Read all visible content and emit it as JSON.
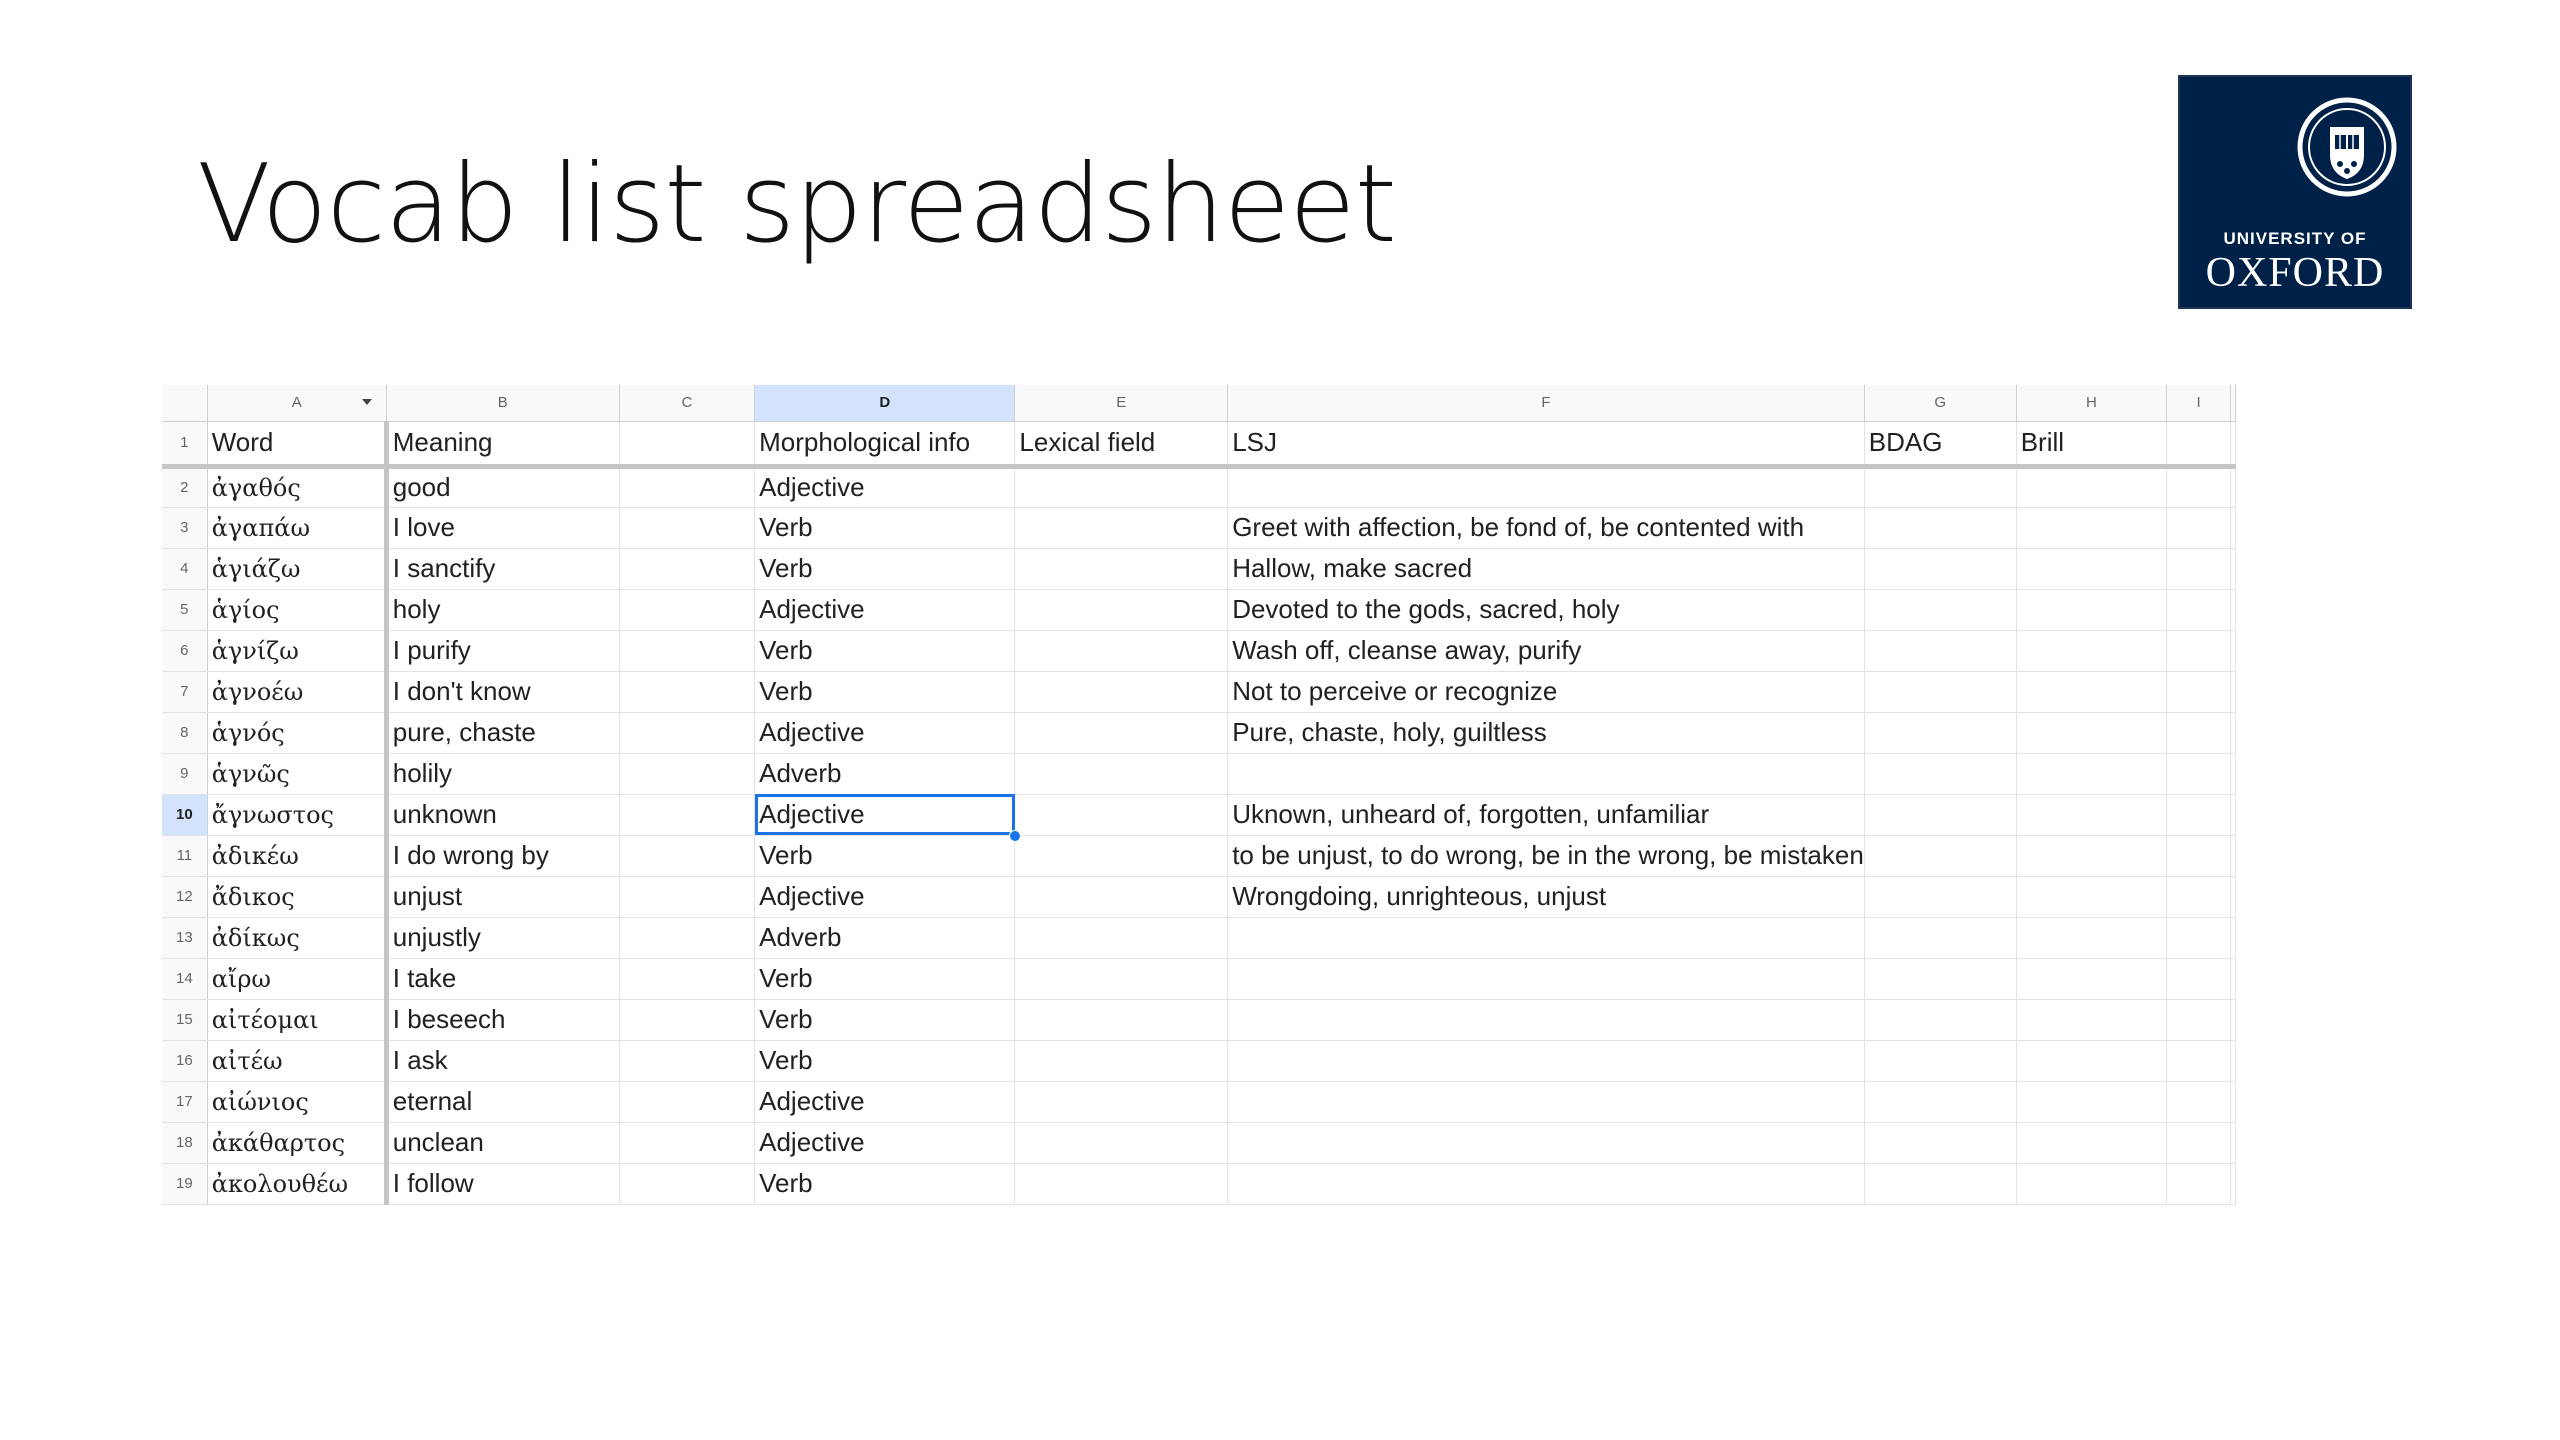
{
  "slide": {
    "title": "Vocab list spreadsheet"
  },
  "logo": {
    "line1": "UNIVERSITY OF",
    "line2": "OXFORD",
    "icon": "oxford-crest-icon",
    "background": "#002147"
  },
  "sheet": {
    "column_letters": [
      "A",
      "B",
      "C",
      "D",
      "E",
      "F",
      "G",
      "H",
      "I"
    ],
    "active_column": "D",
    "active_row": 10,
    "header_row": {
      "row_number": "1",
      "cells": [
        "Word",
        "Meaning",
        "",
        "Morphological info",
        "Lexical field",
        "LSJ",
        "BDAG",
        "Brill",
        ""
      ]
    },
    "rows": [
      {
        "n": "2",
        "word": "ἀγαθός",
        "meaning": "good",
        "c": "",
        "morph": "Adjective",
        "lex": "",
        "lsj": "",
        "bdag": "",
        "brill": ""
      },
      {
        "n": "3",
        "word": "ἀγαπάω",
        "meaning": "I love",
        "c": "",
        "morph": "Verb",
        "lex": "",
        "lsj": "Greet with affection, be fond of, be contented with",
        "bdag": "",
        "brill": ""
      },
      {
        "n": "4",
        "word": "ἁγιάζω",
        "meaning": "I sanctify",
        "c": "",
        "morph": "Verb",
        "lex": "",
        "lsj": "Hallow, make sacred",
        "bdag": "",
        "brill": ""
      },
      {
        "n": "5",
        "word": "ἁγίος",
        "meaning": "holy",
        "c": "",
        "morph": "Adjective",
        "lex": "",
        "lsj": "Devoted to the gods, sacred, holy",
        "bdag": "",
        "brill": ""
      },
      {
        "n": "6",
        "word": "ἁγνίζω",
        "meaning": "I purify",
        "c": "",
        "morph": "Verb",
        "lex": "",
        "lsj": "Wash off, cleanse away, purify",
        "bdag": "",
        "brill": ""
      },
      {
        "n": "7",
        "word": "ἀγνοέω",
        "meaning": "I don't know",
        "c": "",
        "morph": "Verb",
        "lex": "",
        "lsj": "Not to perceive or recognize",
        "bdag": "",
        "brill": ""
      },
      {
        "n": "8",
        "word": "ἁγνός",
        "meaning": "pure, chaste",
        "c": "",
        "morph": "Adjective",
        "lex": "",
        "lsj": "Pure, chaste, holy, guiltless",
        "bdag": "",
        "brill": ""
      },
      {
        "n": "9",
        "word": "ἁγνῶς",
        "meaning": "holily",
        "c": "",
        "morph": "Adverb",
        "lex": "",
        "lsj": "",
        "bdag": "",
        "brill": ""
      },
      {
        "n": "10",
        "word": "ἄγνωστος",
        "meaning": "unknown",
        "c": "",
        "morph": "Adjective",
        "lex": "",
        "lsj": "Uknown, unheard of, forgotten, unfamiliar",
        "bdag": "",
        "brill": ""
      },
      {
        "n": "11",
        "word": "ἀδικέω",
        "meaning": "I do wrong by",
        "c": "",
        "morph": "Verb",
        "lex": "",
        "lsj": "to be unjust, to do wrong, be in the wrong, be mistaken",
        "bdag": "",
        "brill": ""
      },
      {
        "n": "12",
        "word": "ἄδικος",
        "meaning": "unjust",
        "c": "",
        "morph": "Adjective",
        "lex": "",
        "lsj": "Wrongdoing, unrighteous, unjust",
        "bdag": "",
        "brill": ""
      },
      {
        "n": "13",
        "word": "ἀδίκως",
        "meaning": "unjustly",
        "c": "",
        "morph": "Adverb",
        "lex": "",
        "lsj": "",
        "bdag": "",
        "brill": ""
      },
      {
        "n": "14",
        "word": "αἴρω",
        "meaning": "I take",
        "c": "",
        "morph": "Verb",
        "lex": "",
        "lsj": "",
        "bdag": "",
        "brill": ""
      },
      {
        "n": "15",
        "word": "αἰτέομαι",
        "meaning": "I beseech",
        "c": "",
        "morph": "Verb",
        "lex": "",
        "lsj": "",
        "bdag": "",
        "brill": ""
      },
      {
        "n": "16",
        "word": "αἰτέω",
        "meaning": "I ask",
        "c": "",
        "morph": "Verb",
        "lex": "",
        "lsj": "",
        "bdag": "",
        "brill": ""
      },
      {
        "n": "17",
        "word": "αἰώνιος",
        "meaning": "eternal",
        "c": "",
        "morph": "Adjective",
        "lex": "",
        "lsj": "",
        "bdag": "",
        "brill": ""
      },
      {
        "n": "18",
        "word": "ἀκάθαρτος",
        "meaning": "unclean",
        "c": "",
        "morph": "Adjective",
        "lex": "",
        "lsj": "",
        "bdag": "",
        "brill": ""
      },
      {
        "n": "19",
        "word": "ἀκολουθέω",
        "meaning": "I follow",
        "c": "",
        "morph": "Verb",
        "lex": "",
        "lsj": "",
        "bdag": "",
        "brill": ""
      }
    ]
  }
}
